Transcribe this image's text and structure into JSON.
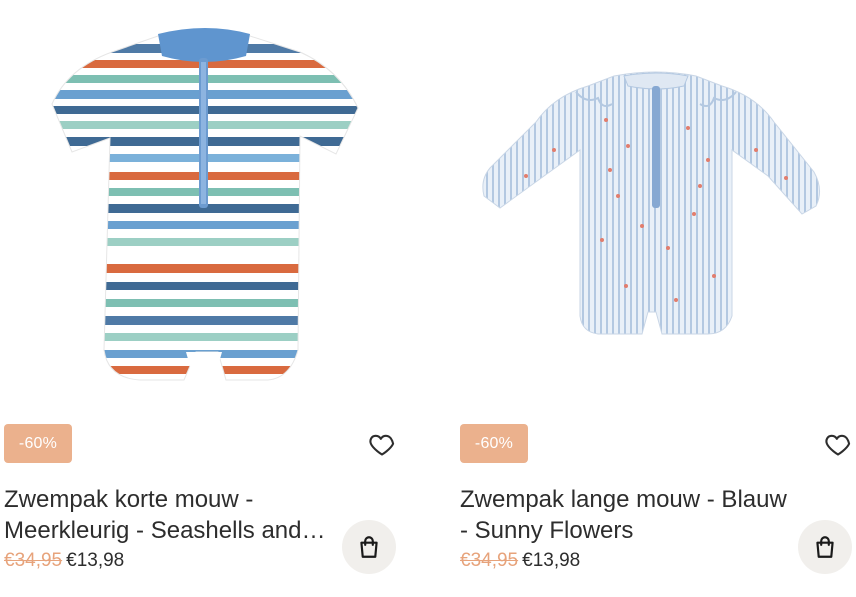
{
  "colors": {
    "badge_bg": "#ebb18d",
    "old_price": "#e7a37b",
    "cart_button_bg": "#f1efec",
    "text": "#2d2d2d"
  },
  "products": [
    {
      "badge": "-60%",
      "title": "Zwempak korte mouw - Meerkleurig - Seashells and Shells",
      "old_price": "€34,95",
      "new_price": "€13,98",
      "image_icon": "striped-short-sleeve-swimsuit",
      "wishlist_icon": "heart-icon",
      "cart_icon": "shopping-bag-icon"
    },
    {
      "badge": "-60%",
      "title": "Zwempak lange mouw - Blauw - Sunny Flowers",
      "old_price": "€34,95",
      "new_price": "€13,98",
      "image_icon": "blue-long-sleeve-swimsuit",
      "wishlist_icon": "heart-icon",
      "cart_icon": "shopping-bag-icon"
    }
  ]
}
